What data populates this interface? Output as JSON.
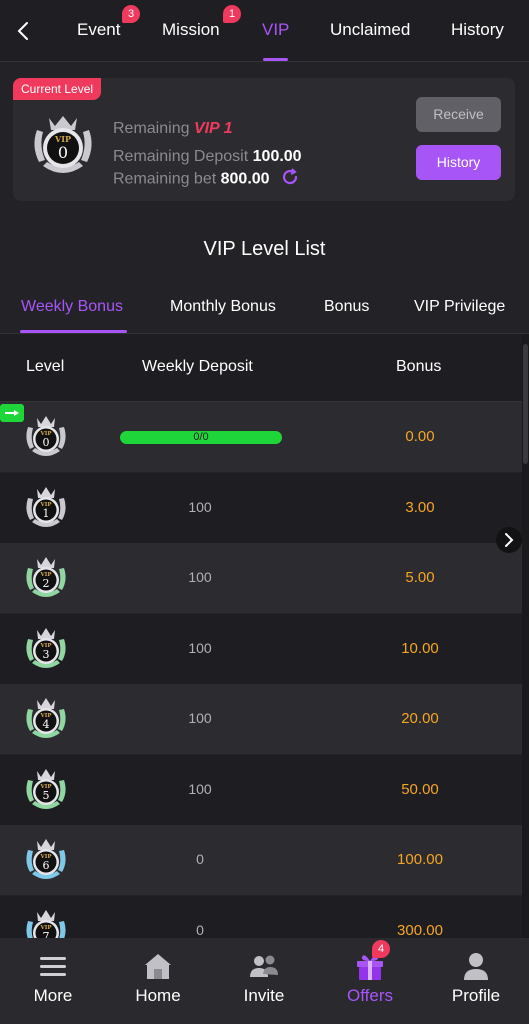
{
  "topnav": {
    "tabs": [
      {
        "label": "Event",
        "badge": "3"
      },
      {
        "label": "Mission",
        "badge": "1"
      },
      {
        "label": "VIP",
        "badge": ""
      },
      {
        "label": "Unclaimed",
        "badge": ""
      },
      {
        "label": "History",
        "badge": ""
      }
    ],
    "active_tab": "VIP",
    "back_icon": "chevron-left-icon"
  },
  "current_level": {
    "tag": "Current Level",
    "medal_level": "0",
    "medal_text": "VIP",
    "remaining_label": "Remaining",
    "remaining_vip": "VIP 1",
    "remaining_deposit_label": "Remaining Deposit",
    "remaining_deposit_value": "100.00",
    "remaining_bet_label": "Remaining bet",
    "remaining_bet_value": "800.00",
    "receive_label": "Receive",
    "history_label": "History"
  },
  "list_title": "VIP Level List",
  "bonus_tabs": {
    "items": [
      "Weekly Bonus",
      "Monthly Bonus",
      "Bonus",
      "VIP Privilege"
    ],
    "active": "Weekly Bonus"
  },
  "table": {
    "headers": {
      "level": "Level",
      "deposit": "Weekly Deposit",
      "bonus": "Bonus"
    },
    "rows": [
      {
        "level": "0",
        "deposit": "0/0",
        "bonus": "0.00",
        "current": true,
        "progress": 1.0
      },
      {
        "level": "1",
        "deposit": "100",
        "bonus": "3.00"
      },
      {
        "level": "2",
        "deposit": "100",
        "bonus": "5.00"
      },
      {
        "level": "3",
        "deposit": "100",
        "bonus": "10.00"
      },
      {
        "level": "4",
        "deposit": "100",
        "bonus": "20.00"
      },
      {
        "level": "5",
        "deposit": "100",
        "bonus": "50.00"
      },
      {
        "level": "6",
        "deposit": "0",
        "bonus": "100.00"
      },
      {
        "level": "7",
        "deposit": "0",
        "bonus": "300.00"
      }
    ],
    "medal_text": "VIP"
  },
  "bottomnav": {
    "items": [
      {
        "label": "More",
        "icon": "menu-icon"
      },
      {
        "label": "Home",
        "icon": "home-icon"
      },
      {
        "label": "Invite",
        "icon": "users-icon"
      },
      {
        "label": "Offers",
        "icon": "gift-icon",
        "badge": "4"
      },
      {
        "label": "Profile",
        "icon": "profile-icon"
      }
    ],
    "active": "Offers"
  },
  "colors": {
    "accent": "#a855f7",
    "badge": "#ef3a5d",
    "bonus": "#f5a524",
    "progress": "#1fd63a"
  }
}
